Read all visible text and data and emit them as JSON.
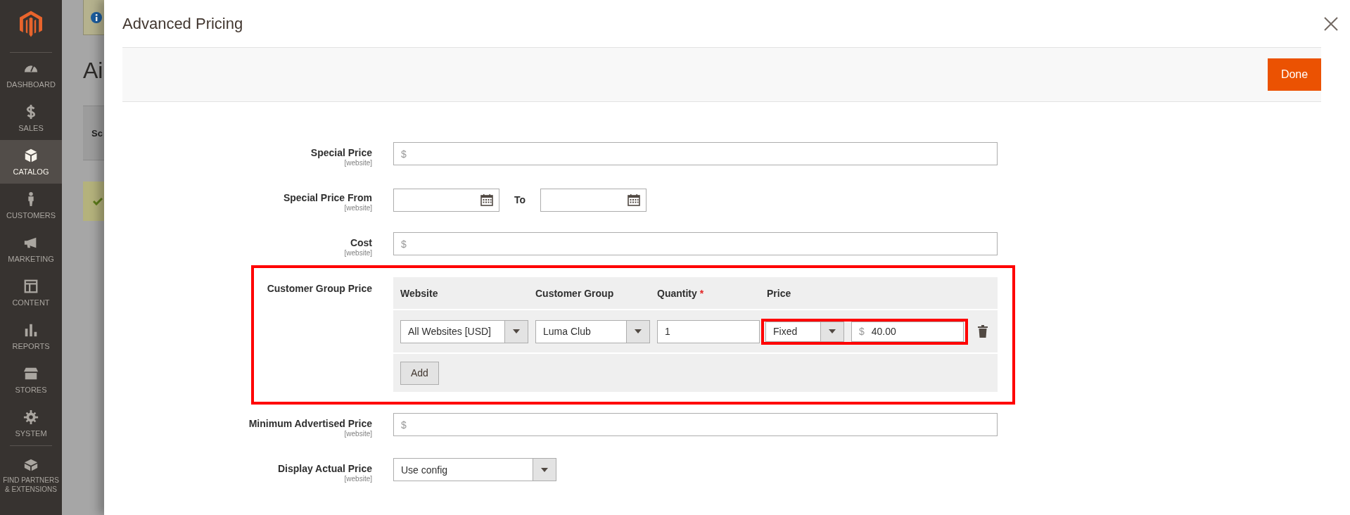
{
  "sidebar": {
    "items": [
      {
        "label": "DASHBOARD",
        "selected": false
      },
      {
        "label": "SALES",
        "selected": false
      },
      {
        "label": "CATALOG",
        "selected": true
      },
      {
        "label": "CUSTOMERS",
        "selected": false
      },
      {
        "label": "MARKETING",
        "selected": false
      },
      {
        "label": "CONTENT",
        "selected": false
      },
      {
        "label": "REPORTS",
        "selected": false
      },
      {
        "label": "STORES",
        "selected": false
      },
      {
        "label": "SYSTEM",
        "selected": false
      },
      {
        "label": "FIND PARTNERS & EXTENSIONS",
        "selected": false
      }
    ]
  },
  "background_page": {
    "title": "Ai",
    "scope_label": "Sc"
  },
  "modal": {
    "title": "Advanced Pricing",
    "done_button": "Done"
  },
  "fields_top": [
    {
      "kind": "price",
      "label": "Special Price",
      "scope": "[website]",
      "currency": "$"
    },
    {
      "kind": "date_range",
      "label": "Special Price From",
      "scope": "[website]",
      "to_label": "To"
    },
    {
      "kind": "price",
      "label": "Cost",
      "scope": "[website]",
      "currency": "$"
    }
  ],
  "customer_group_price": {
    "label": "Customer Group Price",
    "highlighted": true,
    "columns": [
      {
        "label": "Website"
      },
      {
        "label": "Customer Group"
      },
      {
        "label": "Quantity",
        "required_mark": "*"
      },
      {
        "label": "Price"
      }
    ],
    "rows": [
      {
        "website": "All Websites [USD]",
        "customer_group": "Luma Club",
        "quantity": "1",
        "price_type": "Fixed",
        "currency": "$",
        "price": "40.00",
        "price_highlighted": true
      }
    ],
    "add_button": "Add"
  },
  "fields_bottom": [
    {
      "kind": "price",
      "label": "Minimum Advertised Price",
      "scope": "[website]",
      "currency": "$"
    },
    {
      "kind": "select",
      "label": "Display Actual Price",
      "scope": "[website]",
      "value": "Use config"
    }
  ]
}
